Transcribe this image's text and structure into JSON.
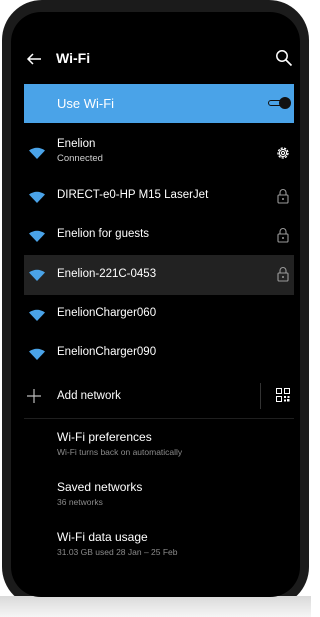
{
  "appbar": {
    "title": "Wi-Fi",
    "back_icon": "arrow-left-icon",
    "search_icon": "search-icon"
  },
  "use_wifi": {
    "label": "Use Wi-Fi",
    "enabled": true,
    "accent": "#4aa3e8"
  },
  "networks": [
    {
      "name": "Enelion",
      "status": "Connected",
      "icon": "wifi-icon",
      "action_icon": "gear-icon"
    },
    {
      "name": "DIRECT-e0-HP M15 LaserJet",
      "icon": "wifi-icon",
      "action_icon": "lock-icon"
    },
    {
      "name": "Enelion for guests",
      "icon": "wifi-icon",
      "action_icon": "lock-icon"
    },
    {
      "name": "Enelion-221C-0453",
      "icon": "wifi-icon",
      "action_icon": "lock-icon"
    },
    {
      "name": "EnelionCharger060",
      "icon": "wifi-icon"
    },
    {
      "name": "EnelionCharger090",
      "icon": "wifi-icon"
    }
  ],
  "add_network": {
    "label": "Add network",
    "icon": "plus-icon",
    "qr_icon": "qr-code-icon"
  },
  "preferences": [
    {
      "title": "Wi-Fi preferences",
      "subtitle": "Wi-Fi turns back on automatically"
    },
    {
      "title": "Saved networks",
      "subtitle": "36 networks"
    },
    {
      "title": "Wi-Fi data usage",
      "subtitle": "31.03 GB used 28 Jan – 25 Feb"
    }
  ]
}
